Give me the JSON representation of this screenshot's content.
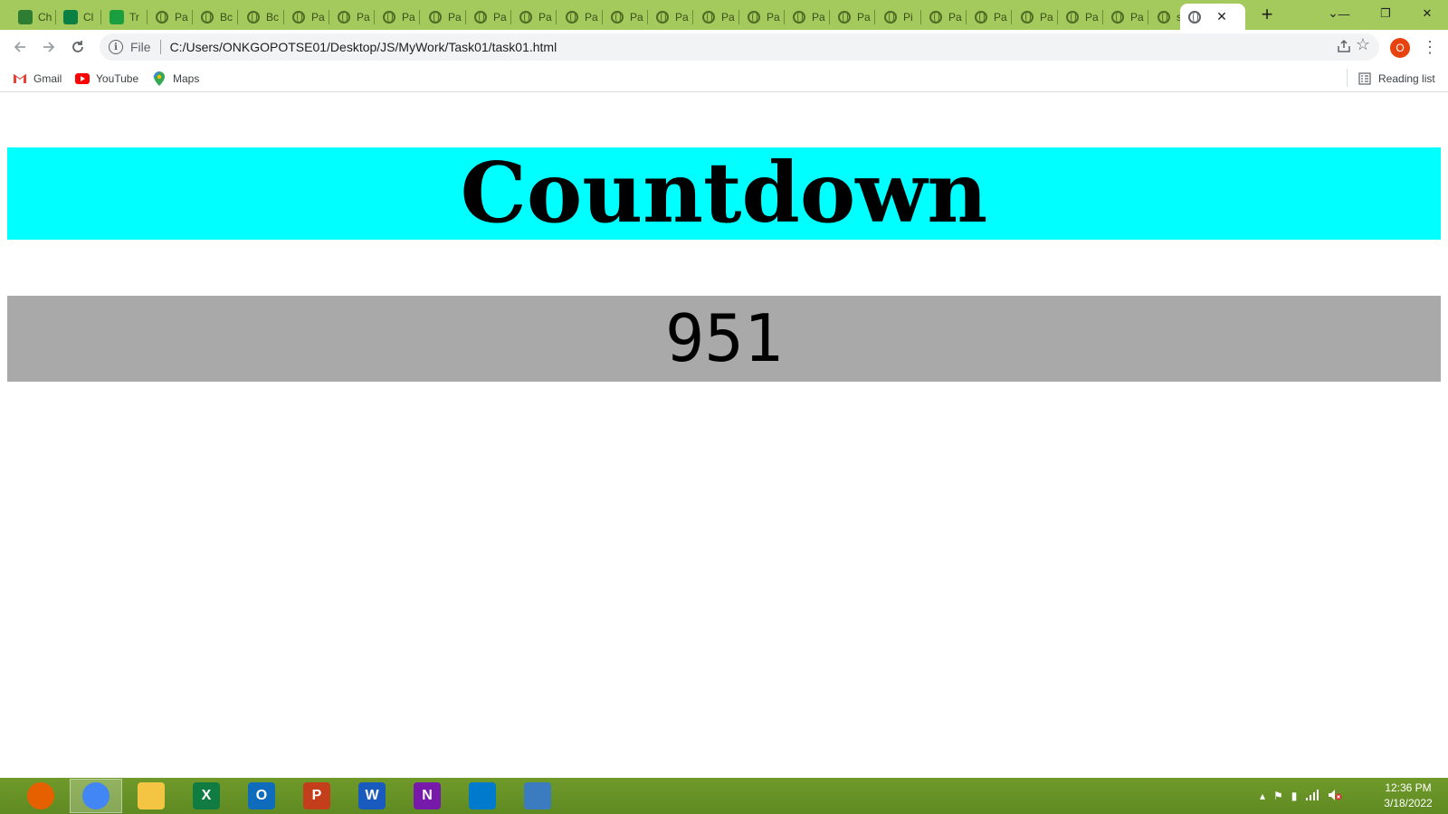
{
  "tabs": [
    {
      "label": "Ch",
      "icon": "cloud-icon",
      "color": "#2e7d32"
    },
    {
      "label": "Cl",
      "icon": "classroom-icon",
      "color": "#0b8043"
    },
    {
      "label": "Tr",
      "icon": "wunderlist-icon",
      "color": "#1b9e3e"
    },
    {
      "label": "Pa",
      "icon": "globe-icon"
    },
    {
      "label": "Bc",
      "icon": "globe-icon"
    },
    {
      "label": "Bc",
      "icon": "globe-icon"
    },
    {
      "label": "Pa",
      "icon": "globe-icon"
    },
    {
      "label": "Pa",
      "icon": "globe-icon"
    },
    {
      "label": "Pa",
      "icon": "globe-icon"
    },
    {
      "label": "Pa",
      "icon": "globe-icon"
    },
    {
      "label": "Pa",
      "icon": "globe-icon"
    },
    {
      "label": "Pa",
      "icon": "globe-icon"
    },
    {
      "label": "Pa",
      "icon": "globe-icon"
    },
    {
      "label": "Pa",
      "icon": "globe-icon"
    },
    {
      "label": "Pa",
      "icon": "globe-icon"
    },
    {
      "label": "Pa",
      "icon": "globe-icon"
    },
    {
      "label": "Pa",
      "icon": "globe-icon"
    },
    {
      "label": "Pa",
      "icon": "globe-icon"
    },
    {
      "label": "Pa",
      "icon": "globe-icon"
    },
    {
      "label": "Pi",
      "icon": "globe-icon"
    },
    {
      "label": "Pa",
      "icon": "globe-icon"
    },
    {
      "label": "Pa",
      "icon": "globe-icon"
    },
    {
      "label": "Pa",
      "icon": "globe-icon"
    },
    {
      "label": "Pa",
      "icon": "globe-icon"
    },
    {
      "label": "Pa",
      "icon": "globe-icon"
    },
    {
      "label": "sh",
      "icon": "globe-icon"
    }
  ],
  "active_tab": {
    "label": "",
    "icon": "globe-icon"
  },
  "window_controls": {
    "minimize": "—",
    "restore": "❐",
    "close": "✕"
  },
  "toolbar": {
    "scheme_label": "File",
    "url": "C:/Users/ONKGOPOTSE01/Desktop/JS/MyWork/Task01/task01.html",
    "profile_initial": "O"
  },
  "bookmarks": [
    {
      "label": "Gmail",
      "icon": "gmail-icon"
    },
    {
      "label": "YouTube",
      "icon": "youtube-icon"
    },
    {
      "label": "Maps",
      "icon": "maps-icon"
    }
  ],
  "reading_list_label": "Reading list",
  "page": {
    "title": "Countdown",
    "counter": "951",
    "title_bg": "#00ffff",
    "counter_bg": "#a9a9a9"
  },
  "taskbar": {
    "apps": [
      {
        "name": "firefox",
        "label": "",
        "color": "#e66000"
      },
      {
        "name": "chrome",
        "label": "",
        "color": "#4285f4",
        "active": true
      },
      {
        "name": "file-explorer",
        "label": "",
        "color": "#f4c542"
      },
      {
        "name": "excel",
        "label": "X",
        "color": "#107c41"
      },
      {
        "name": "outlook",
        "label": "O",
        "color": "#0f6cbd"
      },
      {
        "name": "powerpoint",
        "label": "P",
        "color": "#c43e1c"
      },
      {
        "name": "word",
        "label": "W",
        "color": "#185abd"
      },
      {
        "name": "onenote",
        "label": "N",
        "color": "#7719aa"
      },
      {
        "name": "vscode",
        "label": "",
        "color": "#007acc"
      },
      {
        "name": "photos",
        "label": "",
        "color": "#3b7bbf"
      }
    ],
    "time": "12:36 PM",
    "date": "3/18/2022"
  }
}
